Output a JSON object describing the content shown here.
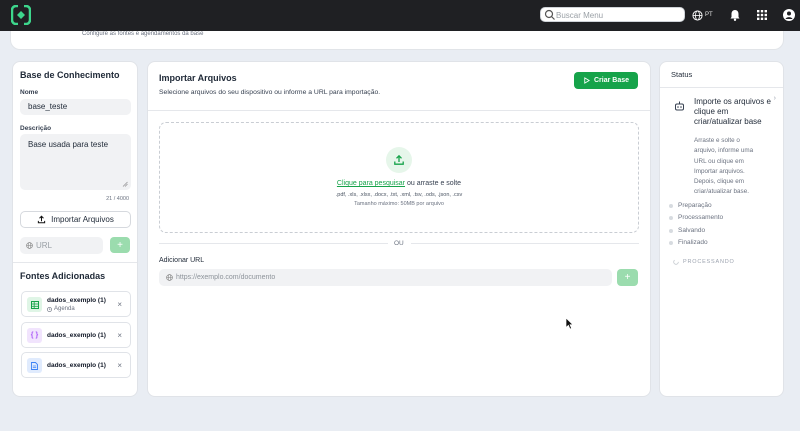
{
  "topbar": {
    "search": {
      "placeholder": "Buscar Menu"
    },
    "language": "PT"
  },
  "header": {
    "subtitle": "Configure as fontes e agendamentos da base"
  },
  "knowledge_base": {
    "title": "Base de Conhecimento",
    "name_label": "Nome",
    "name_value": "base_teste",
    "description_label": "Descrição",
    "description_value": "Base usada para teste",
    "char_count": "21 / 4000",
    "import_button": "Importar Arquivos",
    "url_placeholder": "URL",
    "add_label": "+"
  },
  "sources": {
    "title": "Fontes Adicionadas",
    "items": [
      {
        "name": "dados_exemplo (1)",
        "sub": "Agenda",
        "icon": "table-icon",
        "color": "#16a34a"
      },
      {
        "name": "dados_exemplo (1)",
        "sub": "",
        "icon": "json-icon",
        "color": "#a855f7"
      },
      {
        "name": "dados_exemplo (1)",
        "sub": "",
        "icon": "document-icon",
        "color": "#3b82f6"
      }
    ],
    "close_label": "×"
  },
  "import": {
    "title": "Importar Arquivos",
    "subtitle": "Selecione arquivos do seu dispositivo ou informe a URL para importação.",
    "create_button": "Criar Base",
    "dropzone": {
      "link": "Clique para pesquisar",
      "text": " ou arraste e solte",
      "formats": ".pdf, .xls, .xlsx, .docx, .txt, .xml, .tsv, .ods, .json, .csv",
      "max_size": "Tamanho máximo: 50MB por arquivo"
    },
    "or_label": "OU",
    "url_label": "Adicionar URL",
    "url_placeholder": "https://exemplo.com/documento",
    "add_label": "+"
  },
  "status": {
    "title": "Status",
    "heading": "Importe os arquivos e clique em criar/atualizar base",
    "description": "Arraste e solte o arquivo, informe uma URL ou clique em Importar arquivos. Depois, clique em criar/atualizar base.",
    "steps": [
      "Preparação",
      "Processamento",
      "Salvando",
      "Finalizado"
    ],
    "state": "PROCESSANDO"
  },
  "colors": {
    "accent": "#16a34a",
    "accent_soft": "#9bdcae",
    "topbar": "#1f2023"
  }
}
